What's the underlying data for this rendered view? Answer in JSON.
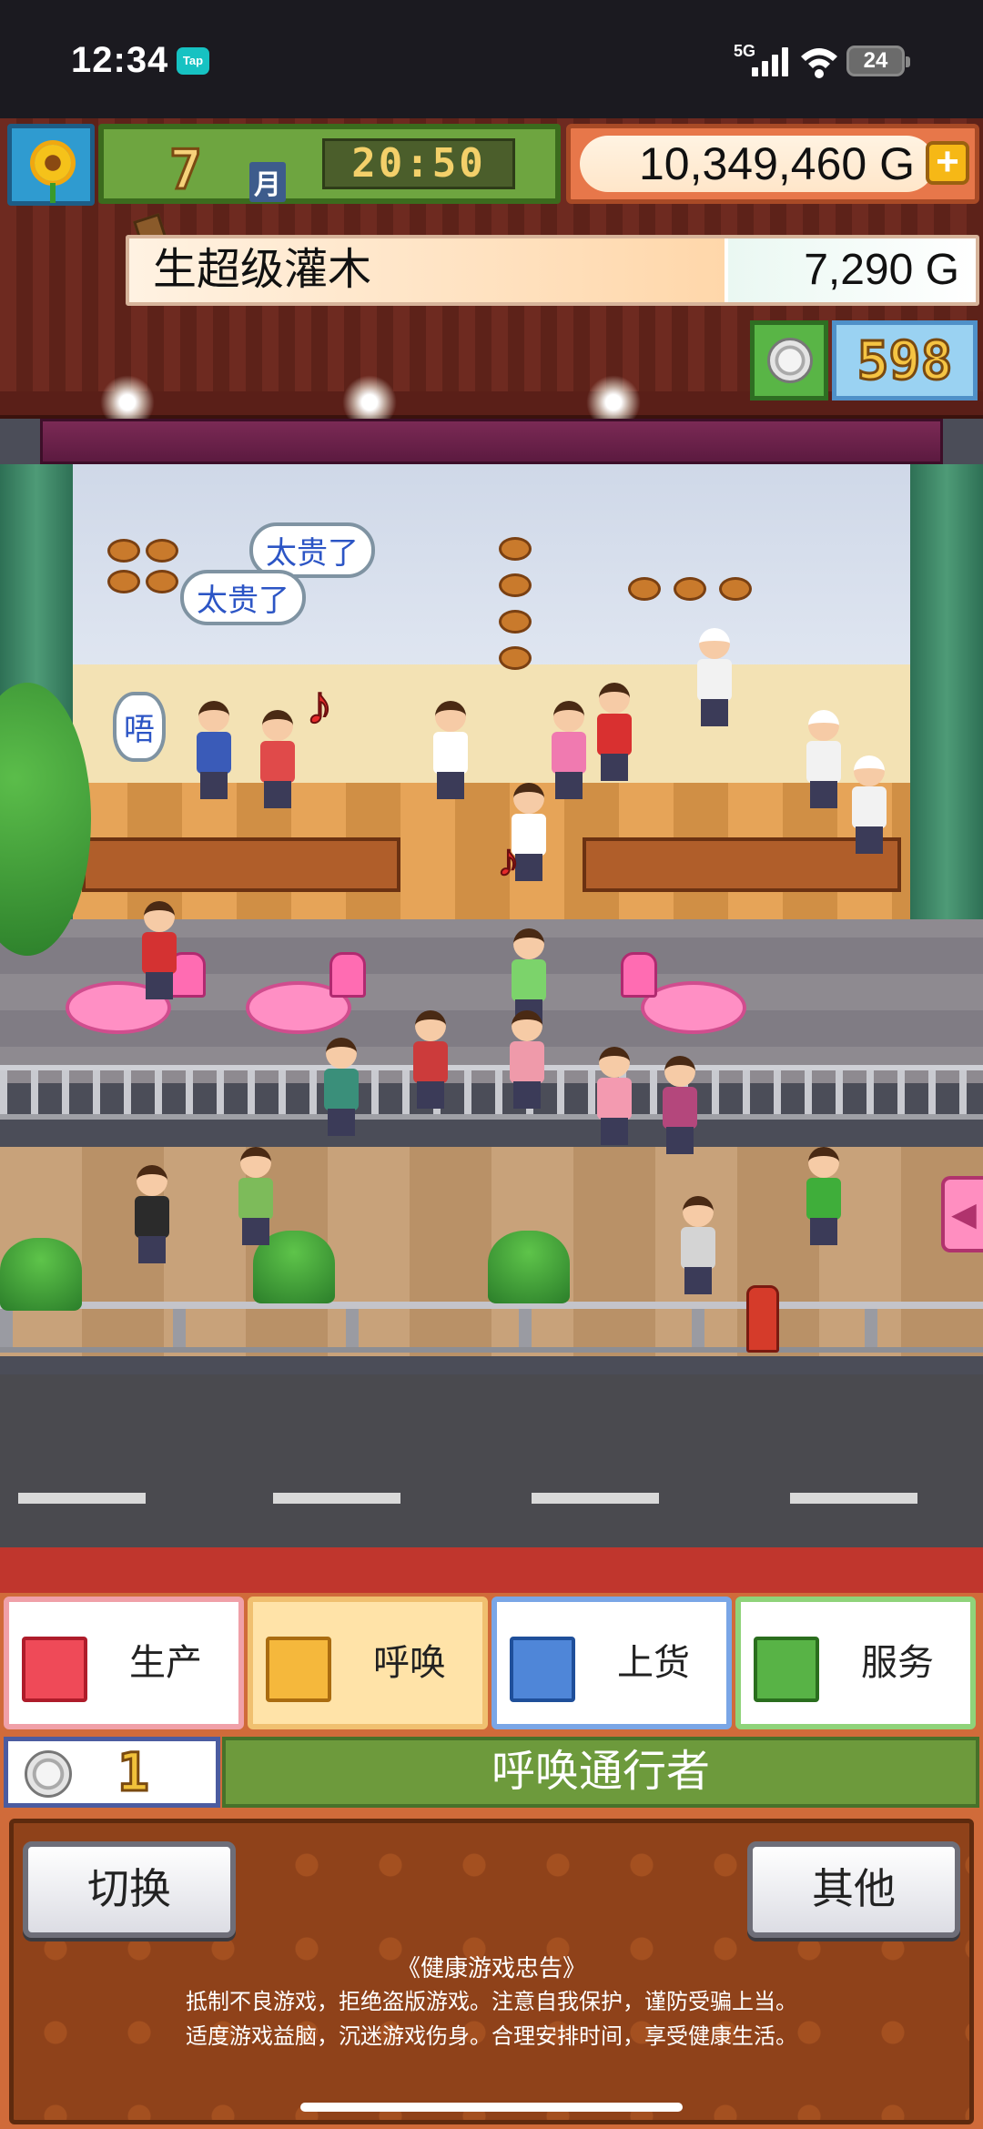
{
  "status_bar": {
    "time": "12:34",
    "app_badge": "Tap",
    "network": "5G",
    "battery": "24"
  },
  "top_hud": {
    "season_icon": "sunflower-icon",
    "month": "7",
    "month_unit": "月",
    "clock": "20:50",
    "money": "10,349,460 G",
    "money_add_icon": "plus-icon"
  },
  "selected_item": {
    "name": "生超级灌木",
    "price": "7,290 G"
  },
  "medals": {
    "icon": "medal-icon",
    "count": "598"
  },
  "scene": {
    "speech_bubbles": [
      "太贵了",
      "太贵了",
      "唔"
    ],
    "side_arrow_icon": "arrow-left-icon"
  },
  "menu": {
    "tabs": [
      {
        "label": "生产",
        "icon": "bread-icon",
        "active": false
      },
      {
        "label": "呼唤",
        "icon": "megaphone-icon",
        "active": true
      },
      {
        "label": "上货",
        "icon": "cake-icon",
        "active": false
      },
      {
        "label": "服务",
        "icon": "teacup-icon",
        "active": false
      }
    ],
    "cost": "1",
    "action_label": "呼唤通行者",
    "switch_label": "切换",
    "other_label": "其他"
  },
  "health_notice": {
    "title": "《健康游戏忠告》",
    "line1": "抵制不良游戏，拒绝盗版游戏。注意自我保护，谨防受骗上当。",
    "line2": "适度游戏益脑，沉迷游戏伤身。合理安排时间，享受健康生活。"
  },
  "colors": {
    "accent_red": "#c0362d",
    "menu_green": "#6d9a3c",
    "money_orange": "#e7774a"
  }
}
